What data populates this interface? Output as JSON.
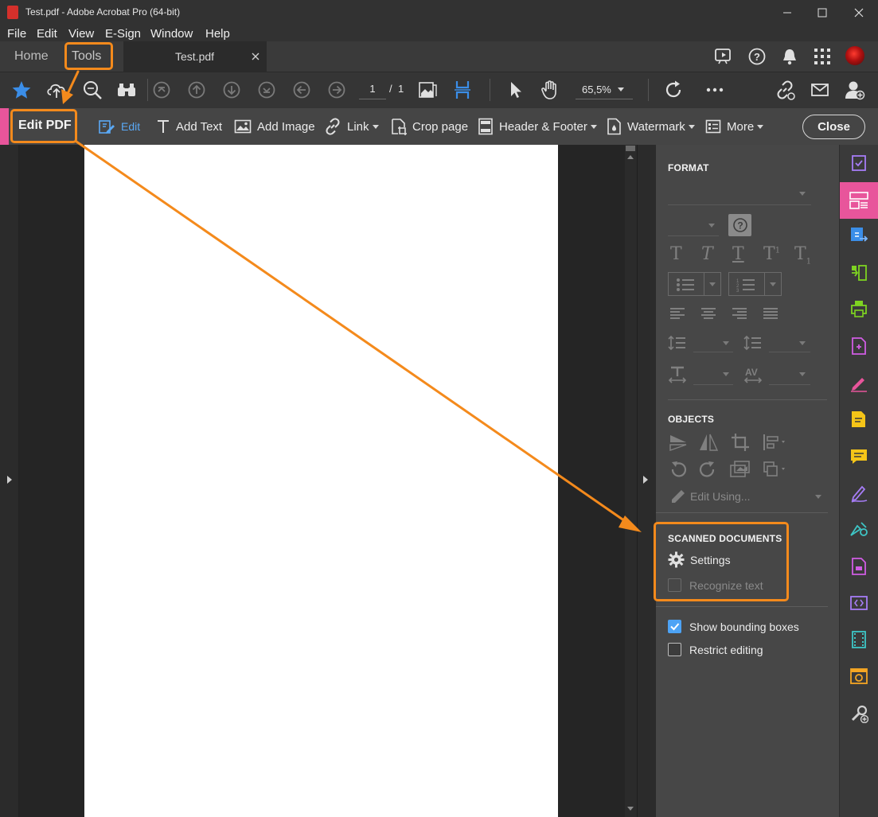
{
  "window": {
    "title": "Test.pdf - Adobe Acrobat Pro (64-bit)"
  },
  "menu": [
    "File",
    "Edit",
    "View",
    "E-Sign",
    "Window",
    "Help"
  ],
  "tabs": {
    "home": "Home",
    "tools": "Tools",
    "document": "Test.pdf"
  },
  "toolbar": {
    "page_current": "1",
    "page_sep": "/",
    "page_total": "1",
    "zoom": "65,5%"
  },
  "edit_toolbar": {
    "title": "Edit PDF",
    "edit": "Edit",
    "add_text": "Add Text",
    "add_image": "Add Image",
    "link": "Link",
    "crop_page": "Crop page",
    "header_footer": "Header & Footer",
    "watermark": "Watermark",
    "more": "More",
    "close": "Close"
  },
  "panel": {
    "format_title": "FORMAT",
    "objects_title": "OBJECTS",
    "edit_using": "Edit Using...",
    "scanned_title": "SCANNED DOCUMENTS",
    "settings": "Settings",
    "recognize_text": "Recognize text",
    "show_bounding_boxes": "Show bounding boxes",
    "show_bounding_boxes_checked": true,
    "restrict_editing": "Restrict editing",
    "restrict_editing_checked": false
  },
  "colors": {
    "accent_blue": "#4da3f5",
    "highlight_orange": "#f48a1c",
    "edit_pink": "#e8559b"
  },
  "rail_icons": [
    "export-pdf-icon",
    "edit-pdf-icon",
    "create-pdf-icon",
    "organize-pages-icon",
    "print-production-icon",
    "protect-icon",
    "fill-sign-icon",
    "comment-icon",
    "sticky-note-icon",
    "request-signature-icon",
    "certificates-icon",
    "scan-ocr-icon",
    "javascript-icon",
    "rich-media-icon",
    "action-wizard-icon",
    "more-tools-icon"
  ]
}
